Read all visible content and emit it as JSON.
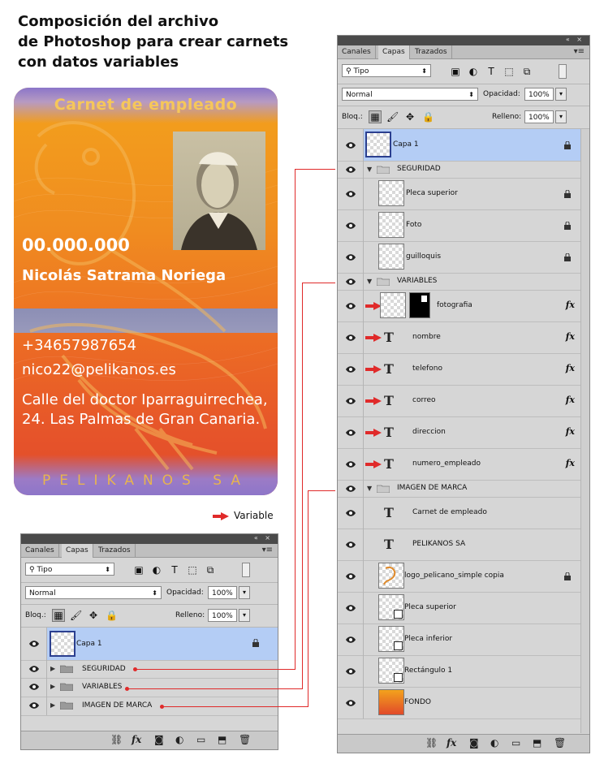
{
  "title_lines": [
    "Composición del archivo",
    "de Photoshop para crear carnets",
    "con datos variables"
  ],
  "card": {
    "title": "Carnet de empleado",
    "number": "00.000.000",
    "name": "Nicolás Satrama Noriega",
    "phone": "+34657987654",
    "email": "nico22@pelikanos.es",
    "address": "Calle del doctor Iparraguirrechea, 24. Las Palmas de Gran Canaria.",
    "company": "PELIKANOS SA",
    "colors": {
      "orange": "#f08c20",
      "red": "#e14a2a",
      "band": "#8aa1d6",
      "purple": "#8d76c9"
    }
  },
  "legend": {
    "label": "Variable",
    "arrow_color": "#e02a2a"
  },
  "panel": {
    "tabs": [
      "Canales",
      "Capas",
      "Trazados"
    ],
    "active_tab": "Capas",
    "filter_select": "Tipo",
    "blend_mode": "Normal",
    "opacity_label": "Opacidad:",
    "opacity_value": "100%",
    "lock_label": "Bloq.:",
    "fill_label": "Relleno:",
    "fill_value": "100%"
  },
  "small_layers": [
    {
      "name": "Capa 1",
      "type": "layer",
      "selected": true,
      "locked": true
    },
    {
      "name": "SEGURIDAD",
      "type": "group"
    },
    {
      "name": "VARIABLES",
      "type": "group"
    },
    {
      "name": "IMAGEN DE MARCA",
      "type": "group"
    }
  ],
  "big_layers": [
    {
      "name": "Capa 1",
      "type": "layer",
      "selected": true,
      "locked": true
    },
    {
      "name": "SEGURIDAD",
      "type": "group-open"
    },
    {
      "name": "Pleca superior",
      "type": "layer",
      "locked": true
    },
    {
      "name": "Foto",
      "type": "layer",
      "locked": true
    },
    {
      "name": "guilloquis",
      "type": "layer",
      "locked": true
    },
    {
      "name": "VARIABLES",
      "type": "group-open"
    },
    {
      "name": "fotografia",
      "type": "masked",
      "variable": true,
      "fx": "fx"
    },
    {
      "name": "nombre",
      "type": "text",
      "variable": true,
      "fx": "fx"
    },
    {
      "name": "telefono",
      "type": "text",
      "variable": true,
      "fx": "fx"
    },
    {
      "name": "correo",
      "type": "text",
      "variable": true,
      "fx": "fx"
    },
    {
      "name": "direccion",
      "type": "text",
      "variable": true,
      "fx": "fx"
    },
    {
      "name": "numero_empleado",
      "type": "text",
      "variable": true,
      "fx": "fx"
    },
    {
      "name": "IMAGEN DE MARCA",
      "type": "group-open"
    },
    {
      "name": "Carnet de empleado",
      "type": "text"
    },
    {
      "name": "PELIKANOS SA",
      "type": "text"
    },
    {
      "name": "logo_pelicano_simple copia",
      "type": "logo",
      "locked": true
    },
    {
      "name": "Pleca superior",
      "type": "shape"
    },
    {
      "name": "Pleca inferior",
      "type": "shape"
    },
    {
      "name": "Rectángulo 1",
      "type": "shape"
    },
    {
      "name": "FONDO",
      "type": "fill"
    }
  ]
}
